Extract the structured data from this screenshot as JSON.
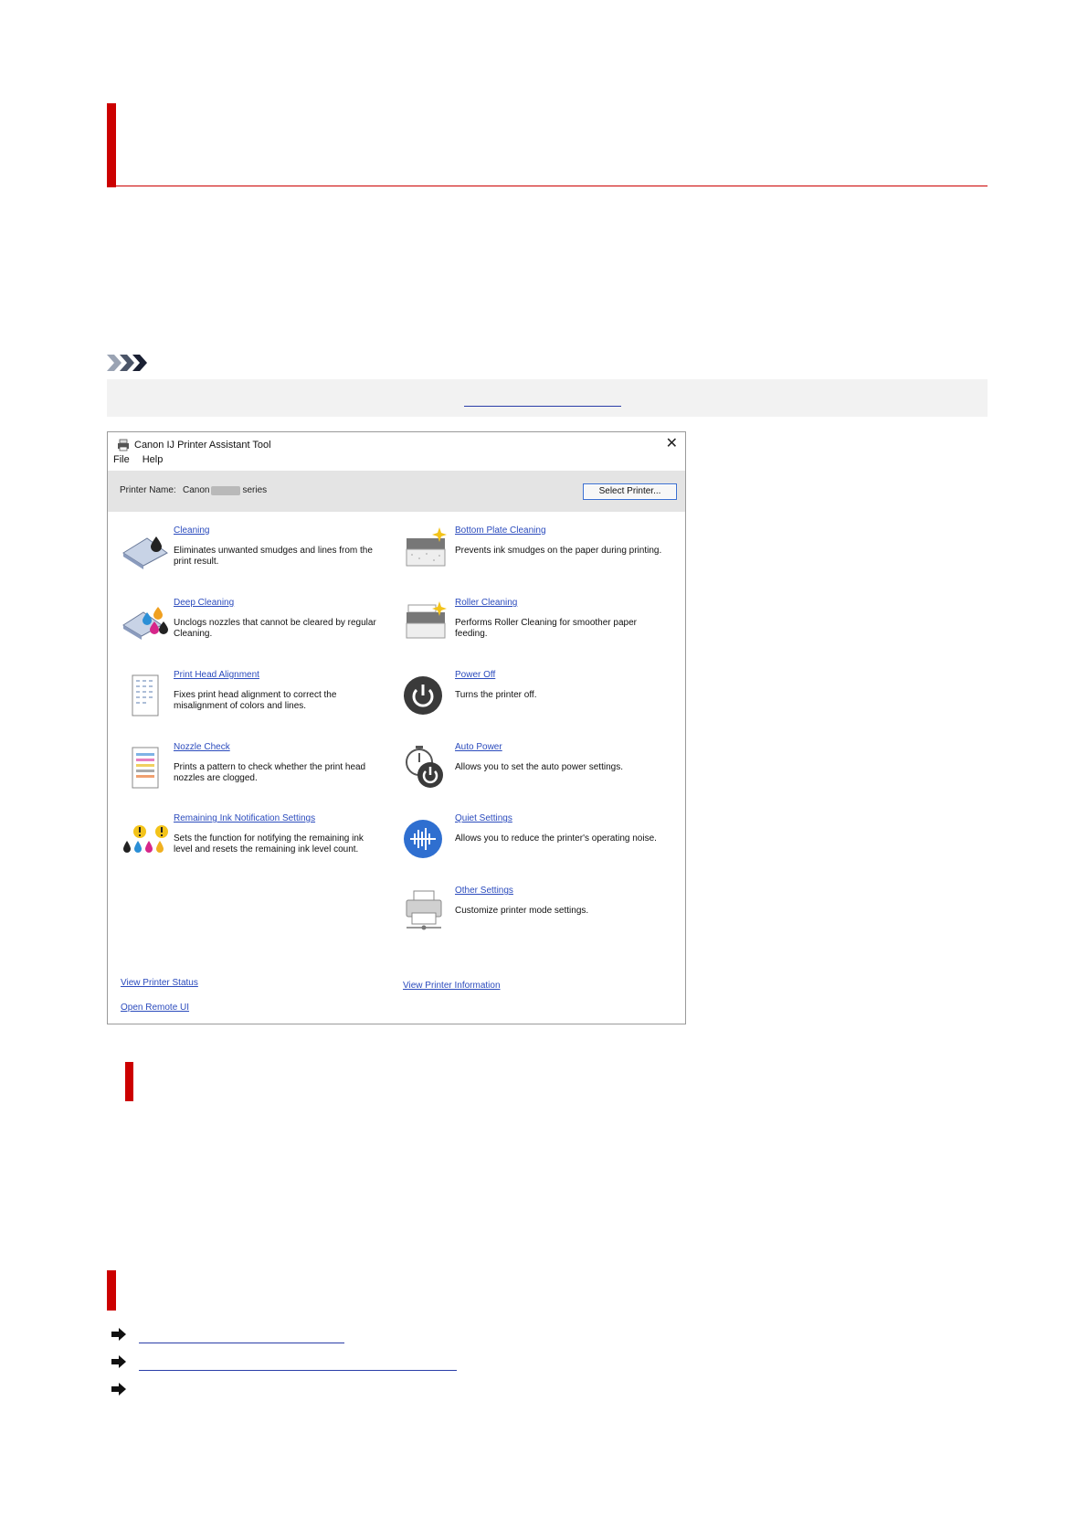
{
  "window": {
    "title": "Canon IJ Printer Assistant Tool",
    "close_glyph": "✕",
    "menu": [
      "File",
      "Help"
    ],
    "printer_name_label": "Printer Name:",
    "printer_name_prefix": "Canon",
    "printer_name_suffix": "series",
    "select_printer_label": "Select Printer..."
  },
  "left_items": [
    {
      "icon": "cleaning-icon",
      "link": "Cleaning",
      "desc": "Eliminates unwanted smudges and lines from the print result."
    },
    {
      "icon": "deep-cleaning-icon",
      "link": "Deep Cleaning",
      "desc": "Unclogs nozzles that cannot be cleared by regular Cleaning."
    },
    {
      "icon": "print-head-alignment-icon",
      "link": "Print Head Alignment",
      "desc": "Fixes print head alignment to correct the misalignment of colors and lines."
    },
    {
      "icon": "nozzle-check-icon",
      "link": "Nozzle Check",
      "desc": "Prints a pattern to check whether the print head nozzles are clogged."
    },
    {
      "icon": "ink-notification-icon",
      "link": "Remaining Ink Notification Settings",
      "desc": "Sets the function for notifying the remaining ink level and resets the remaining ink level count."
    }
  ],
  "right_items": [
    {
      "icon": "bottom-plate-cleaning-icon",
      "link": "Bottom Plate Cleaning",
      "desc": "Prevents ink smudges on the paper during printing."
    },
    {
      "icon": "roller-cleaning-icon",
      "link": "Roller Cleaning",
      "desc": "Performs Roller Cleaning for smoother paper feeding."
    },
    {
      "icon": "power-off-icon",
      "link": "Power Off",
      "desc": "Turns the printer off."
    },
    {
      "icon": "auto-power-icon",
      "link": "Auto Power",
      "desc": "Allows you to set the auto power settings."
    },
    {
      "icon": "quiet-settings-icon",
      "link": "Quiet Settings",
      "desc": "Allows you to reduce the printer's operating noise."
    },
    {
      "icon": "other-settings-icon",
      "link": "Other Settings",
      "desc": "Customize printer mode settings."
    }
  ],
  "footer_links": {
    "view_printer_status": "View Printer Status",
    "open_remote_ui": "Open Remote UI",
    "view_printer_information": "View Printer Information"
  },
  "colors": {
    "accent_red": "#cc0000",
    "link_blue": "#2b4bbd"
  }
}
